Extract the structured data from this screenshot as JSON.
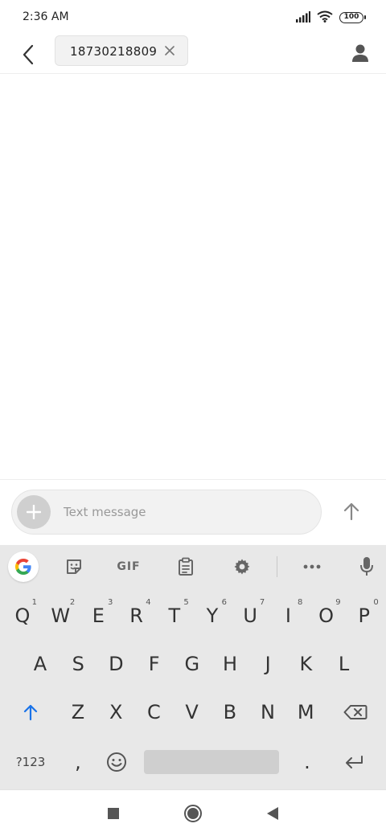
{
  "status_bar": {
    "time": "2:36 AM",
    "battery": "100",
    "icons": [
      "signal-icon",
      "wifi-icon",
      "battery-icon"
    ]
  },
  "header": {
    "back_icon": "back-chevron-icon",
    "recipient": "18730218809",
    "chip_close_icon": "close-icon",
    "contact_icon": "person-icon"
  },
  "compose": {
    "attach_icon": "plus-icon",
    "placeholder": "Text message",
    "value": "",
    "send_icon": "send-arrow-icon"
  },
  "keyboard": {
    "toolbar": {
      "items": [
        "google-icon",
        "sticker-icon",
        "gif",
        "clipboard-icon",
        "settings-icon",
        "more-icon",
        "mic-icon"
      ],
      "gif_label": "GIF"
    },
    "rows": [
      [
        {
          "k": "Q",
          "h": "1"
        },
        {
          "k": "W",
          "h": "2"
        },
        {
          "k": "E",
          "h": "3"
        },
        {
          "k": "R",
          "h": "4"
        },
        {
          "k": "T",
          "h": "5"
        },
        {
          "k": "Y",
          "h": "6"
        },
        {
          "k": "U",
          "h": "7"
        },
        {
          "k": "I",
          "h": "8"
        },
        {
          "k": "O",
          "h": "9"
        },
        {
          "k": "P",
          "h": "0"
        }
      ],
      [
        {
          "k": "A"
        },
        {
          "k": "S"
        },
        {
          "k": "D"
        },
        {
          "k": "F"
        },
        {
          "k": "G"
        },
        {
          "k": "H"
        },
        {
          "k": "J"
        },
        {
          "k": "K"
        },
        {
          "k": "L"
        }
      ],
      [
        {
          "k": "Z"
        },
        {
          "k": "X"
        },
        {
          "k": "C"
        },
        {
          "k": "V"
        },
        {
          "k": "B"
        },
        {
          "k": "N"
        },
        {
          "k": "M"
        }
      ]
    ],
    "symbols_label": "?123",
    "comma": ",",
    "period": ".",
    "accent_color": "#1a73e8"
  },
  "nav_bar": {
    "icons": [
      "recents-square-icon",
      "home-circle-icon",
      "back-triangle-icon"
    ]
  }
}
